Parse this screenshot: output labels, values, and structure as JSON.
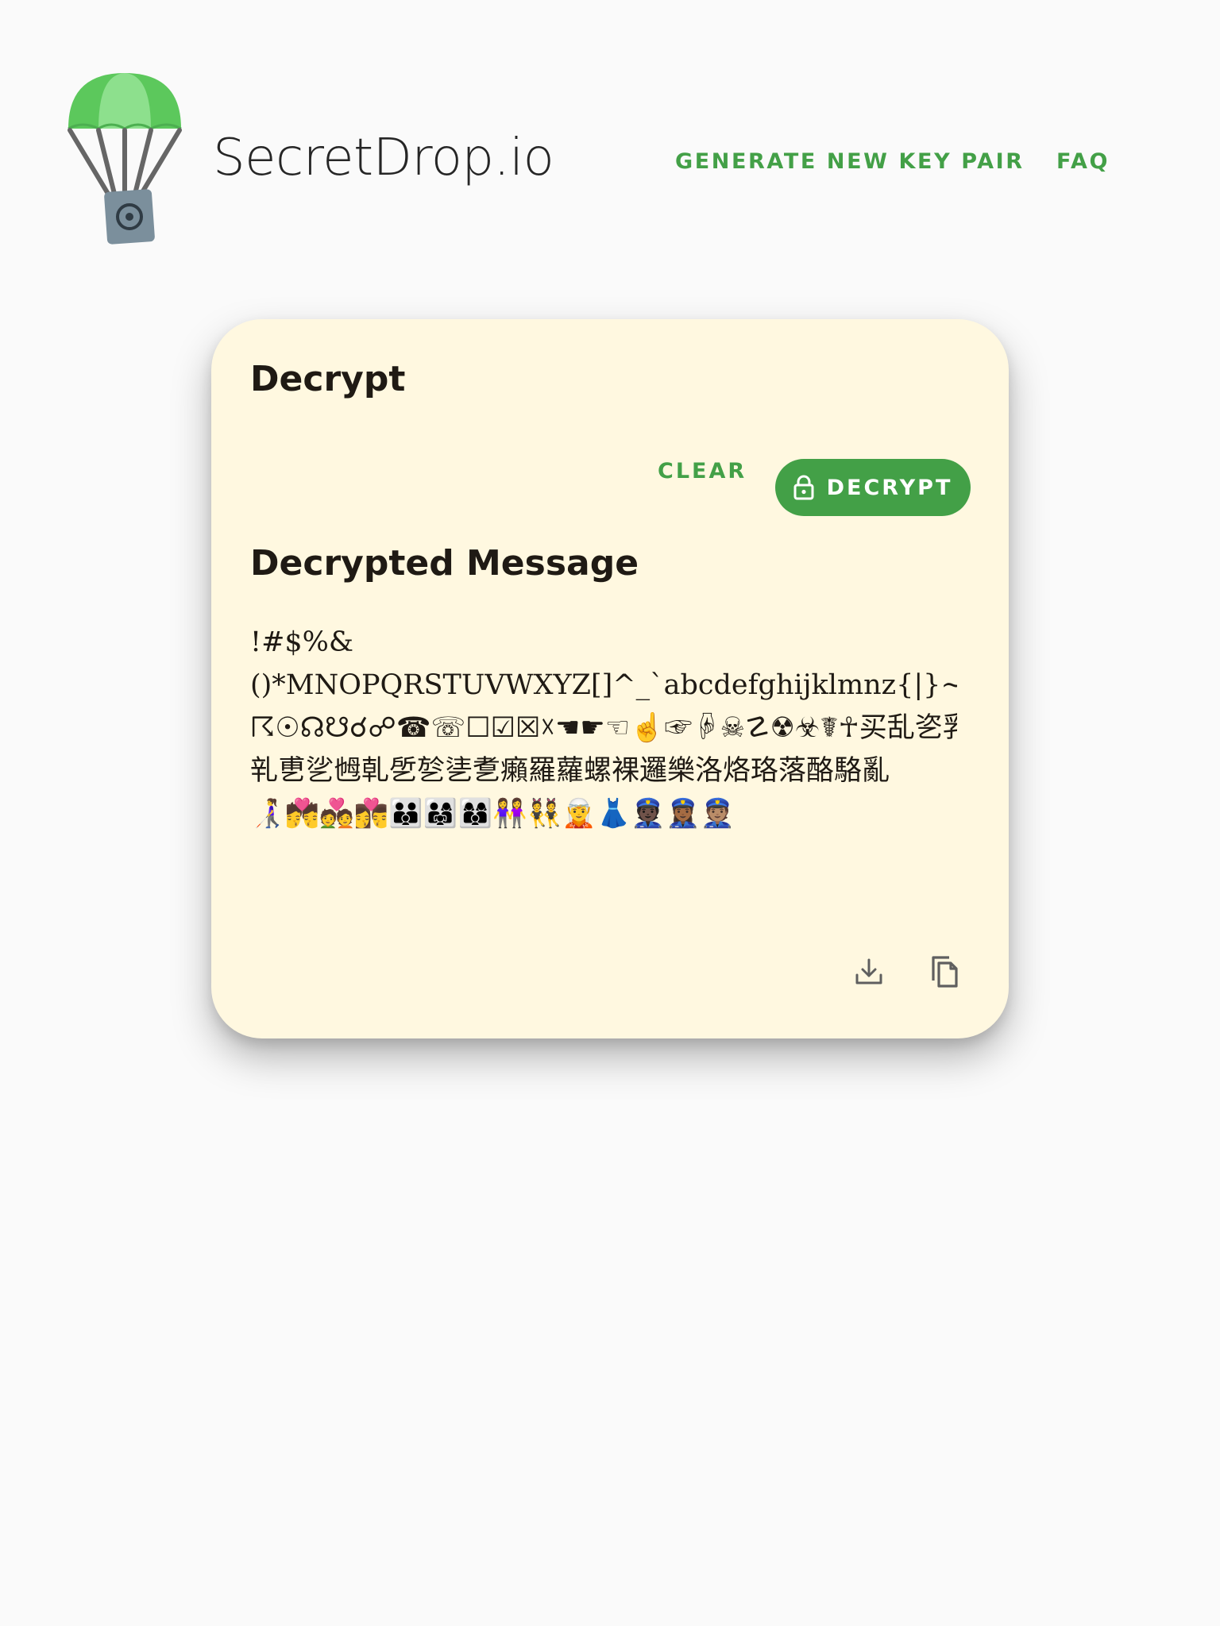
{
  "header": {
    "site_title": "SecretDrop.io",
    "nav": {
      "generate_label": "GENERATE NEW KEY PAIR",
      "faq_label": "FAQ"
    }
  },
  "card": {
    "title": "Decrypt",
    "clear_label": "CLEAR",
    "decrypt_label": "DECRYPT",
    "result_title": "Decrypted Message",
    "message_lines": [
      "!#$%&",
      "()*MNOPQRSTUVWXYZ[]^_`abcdefghijklmnz{|}~☇",
      "☈☉☊☋☌☍☎☏☐☑☒☓☚☛☜☝☞☟☠☡☢☣☤☥买乱乲乳乴",
      "乵乶乷乸乹乺乻乼乽癩羅蘿螺裸邏樂洛烙珞落酪駱亂",
      "👩‍🦯💏💑👩‍❤️‍💋‍👨👪👨‍👩‍👧👩‍👩‍👦👭👯🧝👗👮🏿👮🏾‍♀️👮🏽"
    ]
  },
  "colors": {
    "accent": "#43a047",
    "card_background": "#fff8e0",
    "page_background": "#fafafa"
  },
  "icons": {
    "logo": "parachute-safe-icon",
    "decrypt": "lock-icon",
    "download": "download-icon",
    "copy": "copy-icon"
  }
}
